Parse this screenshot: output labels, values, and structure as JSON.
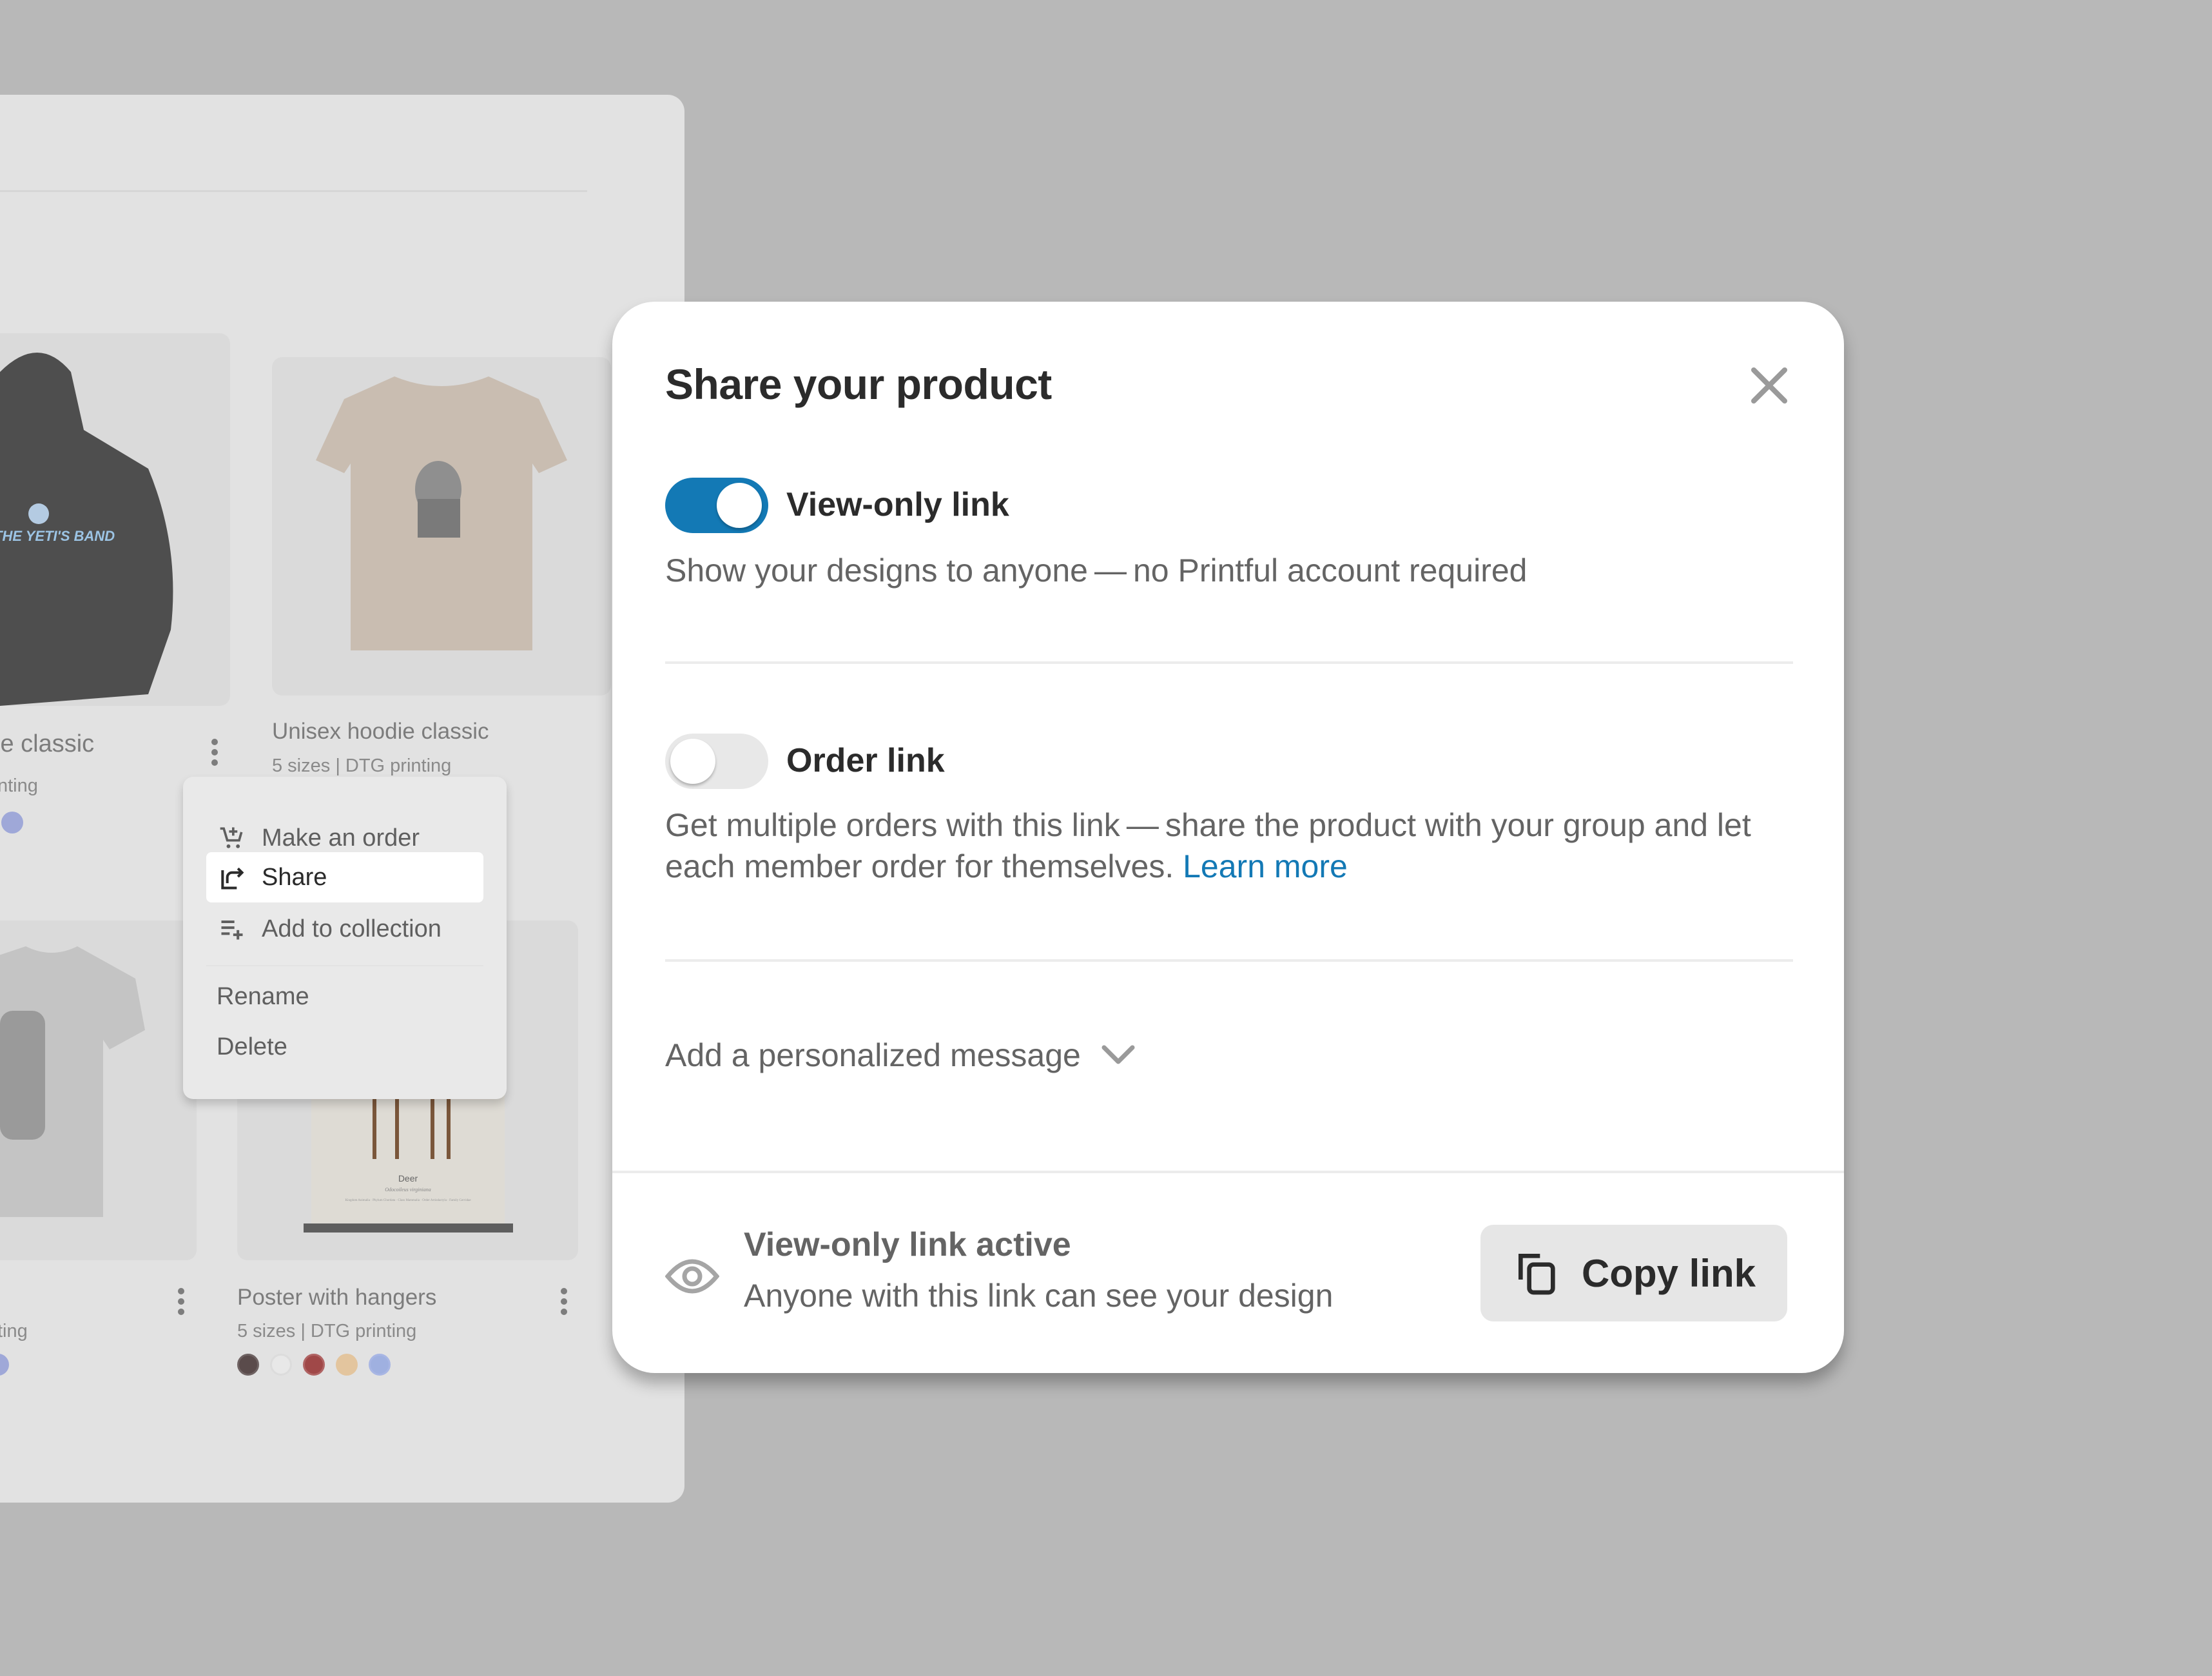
{
  "background": {
    "products": [
      {
        "title": "ie classic",
        "subtitle": "nting",
        "swatches": [
          "#9fa8d8"
        ]
      },
      {
        "title": "Unisex hoodie classic",
        "subtitle": "5 sizes | DTG printing",
        "swatches": []
      },
      {
        "title": "",
        "subtitle": "ting",
        "swatches": [
          "#9fa8d8"
        ]
      },
      {
        "title": "Poster with hangers",
        "subtitle": "5 sizes | DTG printing",
        "swatches": [
          "#5a4b4b",
          "#e8e8e8",
          "#a04848",
          "#e3c59e",
          "#9fb0e0"
        ]
      }
    ],
    "hoodie_print": "THE YETI'S BAND",
    "poster": {
      "title": "Deer",
      "subtitle": "Odocoileus virginiana",
      "caption": "Kingdom Animalia · Phylum Chordata · Class Mammalia · Order Artiodactyla · Family Cervidae"
    }
  },
  "context_menu": {
    "items": [
      {
        "label": "Make an order",
        "icon": "cart-plus-icon"
      },
      {
        "label": "Share",
        "icon": "share-icon",
        "active": true
      },
      {
        "label": "Add to collection",
        "icon": "playlist-add-icon"
      },
      {
        "label": "Rename"
      },
      {
        "label": "Delete"
      }
    ]
  },
  "modal": {
    "title": "Share your product",
    "close_icon": "close-icon",
    "view_only": {
      "label": "View-only link",
      "enabled": true,
      "description": "Show your designs to anyone — no Printful account required"
    },
    "order_link": {
      "label": "Order link",
      "enabled": false,
      "description": "Get multiple orders with this link — share the product with your group and let each member order for themselves.",
      "learn_more": "Learn more"
    },
    "personalized_message": "Add a personalized message",
    "footer": {
      "status_title": "View-only link active",
      "status_subtitle": "Anyone with this link can see your design",
      "copy_button": "Copy link"
    },
    "accent_color": "#1379b5"
  }
}
